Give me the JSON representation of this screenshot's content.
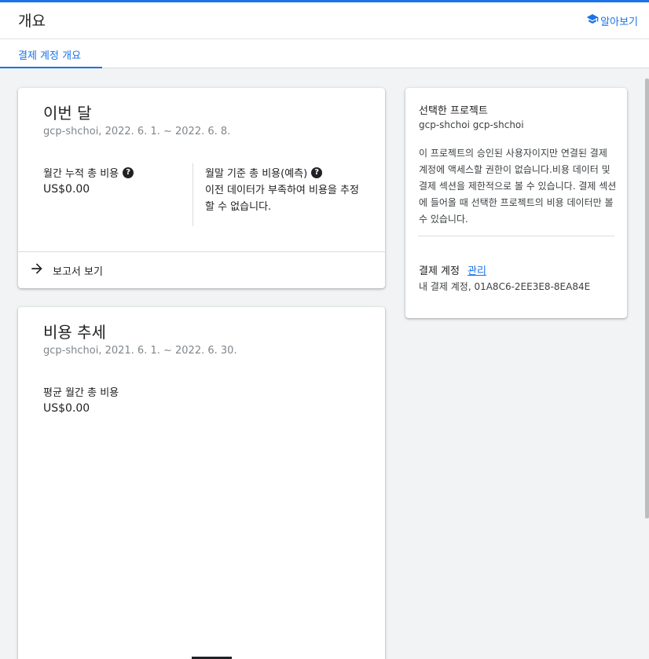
{
  "header": {
    "title": "개요",
    "learn_label": "알아보기",
    "accent": "#1a73e8"
  },
  "tabs": [
    {
      "label": "결제 계정 개요",
      "active": true
    }
  ],
  "this_month": {
    "title": "이번 달",
    "subtitle": "gcp-shchoi, 2022. 6. 1. ~ 2022. 6. 8.",
    "mtd_label": "월간 누적 총 비용",
    "mtd_value": "US$0.00",
    "forecast_label": "월말 기준 총 비용(예측)",
    "forecast_note": "이전 데이터가 부족하여 비용을 추정할 수 없습니다.",
    "report_link": "보고서 보기"
  },
  "cost_trend": {
    "title": "비용 추세",
    "subtitle": "gcp-shchoi, 2021. 6. 1. ~ 2022. 6. 30.",
    "avg_label": "평균 월간 총 비용",
    "avg_value": "US$0.00"
  },
  "project_panel": {
    "label": "선택한 프로젝트",
    "project_name": "gcp-shchoi gcp-shchoi",
    "description": "이 프로젝트의 승인된 사용자이지만 연결된 결제 계정에 액세스할 권한이 없습니다.비용 데이터 및 결제 섹션을 제한적으로 볼 수 있습니다. 결제 섹션에 들어올 때 선택한 프로젝트의 비용 데이터만 볼 수 있습니다.",
    "billing_account_label": "결제 계정",
    "manage_label": "관리",
    "billing_account_value": "내 결제 계정, 01A8C6-2EE3E8-8EA84E"
  },
  "icons": {
    "help": "?",
    "learn": "school-icon",
    "report": "arrow-right-icon"
  }
}
